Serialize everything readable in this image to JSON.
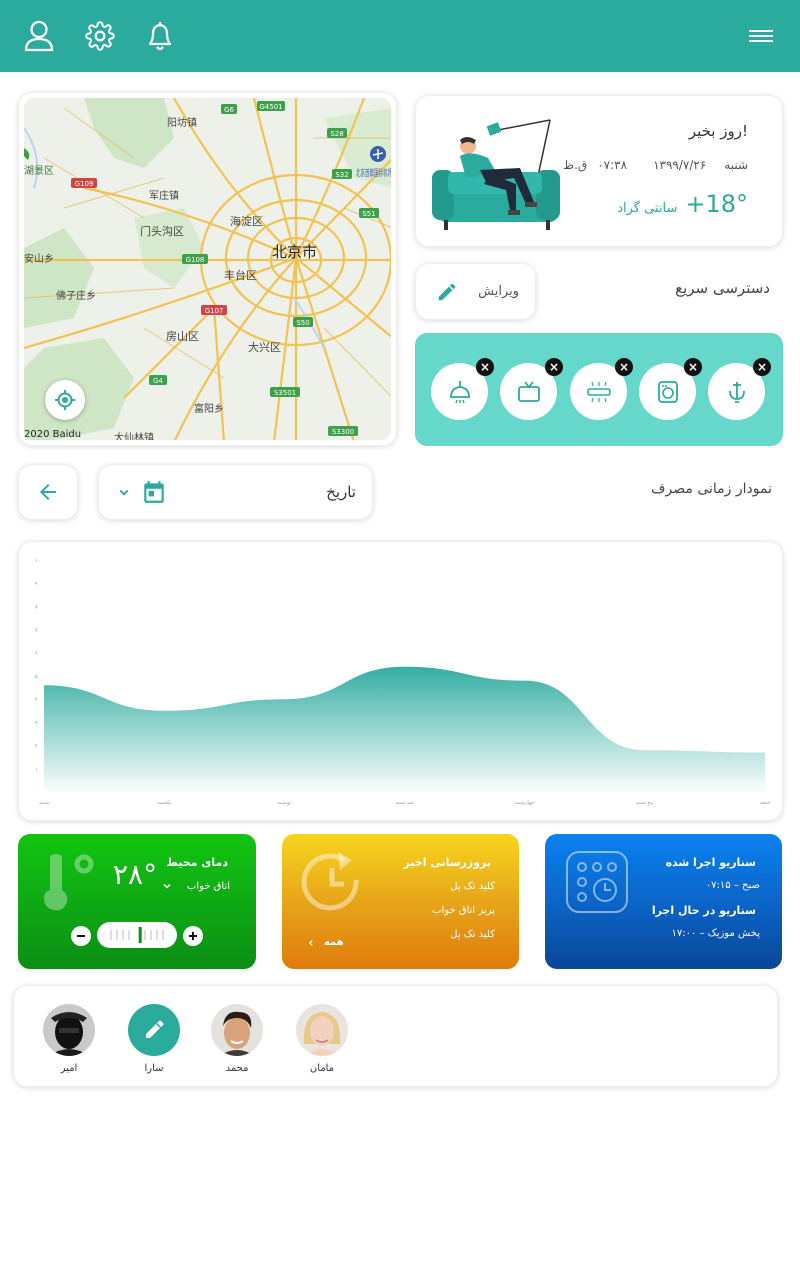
{
  "header": {
    "menu_icon": "hamburger-icon",
    "icons": [
      "user-icon",
      "gear-icon",
      "bell-icon"
    ],
    "color": "#2baa9e"
  },
  "map": {
    "labels": {
      "center_city": "北京市",
      "haidian": "海淀区",
      "mentougou": "门头沟区",
      "fengtai": "丰台区",
      "fangshan": "房山区",
      "daxing": "大兴区",
      "yangfang": "阳坊镇",
      "wangjia": "军庄镇",
      "changxin": "佛子庄乡",
      "beijing_airport": "北京首都国际机场",
      "huyuan": "湖景区",
      "xiaan": "安山乡",
      "ying": "霞云岭",
      "fenghuang": "长阳镇",
      "dongxian": "富阳乡",
      "xianlin": "大仙林镇"
    },
    "highways": [
      "G6",
      "G4501",
      "S28",
      "S32",
      "S51",
      "G109",
      "G108",
      "G107",
      "S50",
      "G4",
      "S3501",
      "S3300"
    ],
    "copyright": "2020 Baidu"
  },
  "welcome": {
    "greeting": "روز بخیر!",
    "day": "شنبه",
    "date": "۱۳۹۹/۷/۲۶",
    "time": "۰۷:۳۸",
    "ampm": "ق.ظ",
    "temp": "+18°",
    "unit": "سانتی گراد"
  },
  "quick_access": {
    "title": "دسترسی سریع",
    "edit_label": "ویرایش",
    "devices": [
      "lamp-icon",
      "tv-icon",
      "air-conditioner-icon",
      "washing-machine-icon",
      "faucet-icon"
    ]
  },
  "usage_chart": {
    "title": "نمودار زمانی مصرف",
    "date_label": "تاریخ",
    "accent": "#2baa9e"
  },
  "chart_data": {
    "type": "area",
    "x": [
      "شنبه",
      "یکشنبه",
      "دوشنبه",
      "سه شنبه",
      "چهارشنبه",
      "پنج شنبه",
      "جمعه"
    ],
    "values": [
      4.6,
      3.5,
      4.0,
      5.4,
      4.8,
      1.8,
      1.7
    ],
    "ylim": [
      0,
      10
    ],
    "yticks": [
      "",
      "۱",
      "",
      "۲",
      "۳",
      "۴",
      "۵",
      "۶",
      "۷",
      "۸",
      "۹",
      "۱۰"
    ],
    "grid": false
  },
  "tiles": {
    "ambient": {
      "title": "دمای محیط",
      "room": "اتاق خواب",
      "temp": "۲۸°",
      "level": 0.55
    },
    "updates": {
      "title": "بروزرسانی اخیر",
      "items": [
        "کلید تک پل",
        "پریز اتاق خواب",
        "کلید تک پل"
      ],
      "all_label": "همه"
    },
    "scenario": {
      "executed_title": "سناریو اجرا شده",
      "executed_value": "صبح – ۰۷:۱۵",
      "running_title": "سناریو در حال اجرا",
      "running_value": "پخش موزیک – ۱۷:۰۰"
    }
  },
  "users": [
    {
      "name": "مامان",
      "avatar": "woman-avatar"
    },
    {
      "name": "محمد",
      "avatar": "man-avatar"
    },
    {
      "name": "سارا",
      "avatar": "edit-avatar"
    },
    {
      "name": "امیر",
      "avatar": "masked-man-avatar"
    }
  ]
}
